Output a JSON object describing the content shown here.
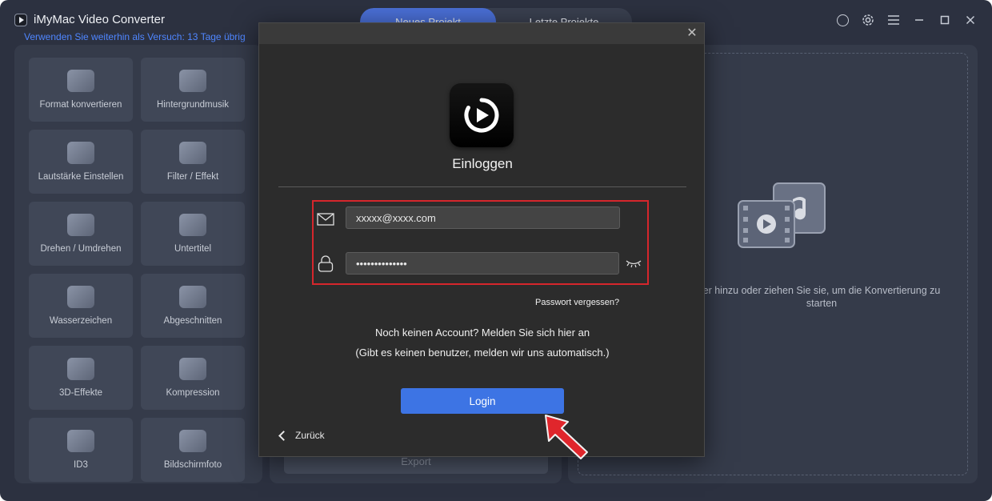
{
  "app": {
    "title": "iMyMac Video Converter",
    "trial_notice": "Verwenden Sie weiterhin als Versuch: 13 Tage übrig",
    "tabs": [
      {
        "label": "Neues Projekt",
        "active": true
      },
      {
        "label": "Letzte Projekte",
        "active": false
      }
    ],
    "window_icons": [
      "account-icon",
      "settings-icon",
      "menu-icon",
      "minimize-icon",
      "maximize-icon",
      "close-icon"
    ]
  },
  "tools": [
    {
      "label": "Format konvertieren",
      "icon": "format-convert-icon"
    },
    {
      "label": "Hintergrundmusik",
      "icon": "background-music-icon"
    },
    {
      "label": "Lautstärke Einstellen",
      "icon": "volume-icon"
    },
    {
      "label": "Filter / Effekt",
      "icon": "filter-effect-icon"
    },
    {
      "label": "Drehen / Umdrehen",
      "icon": "rotate-flip-icon"
    },
    {
      "label": "Untertitel",
      "icon": "subtitle-icon"
    },
    {
      "label": "Wasserzeichen",
      "icon": "watermark-icon"
    },
    {
      "label": "Abgeschnitten",
      "icon": "crop-icon"
    },
    {
      "label": "3D-Effekte",
      "icon": "3d-glasses-icon"
    },
    {
      "label": "Kompression",
      "icon": "compression-icon"
    },
    {
      "label": "ID3",
      "icon": "id3-icon"
    },
    {
      "label": "Bildschirmfoto",
      "icon": "screenshot-icon"
    }
  ],
  "middle": {
    "export_label": "Export"
  },
  "drop": {
    "text_line1": "er hinzu oder ziehen Sie sie, um die Konvertierung zu",
    "text_line2": "starten"
  },
  "login": {
    "title": "Einloggen",
    "email_value": "xxxxx@xxxx.com",
    "password_value": "••••••••••••••",
    "forgot_label": "Passwort vergessen?",
    "no_account": "Noch keinen Account? Melden Sie sich hier an",
    "auto_note": "(Gibt es keinen benutzer, melden wir uns automatisch.)",
    "login_button": "Login",
    "back_label": "Zurück"
  },
  "colors": {
    "accent": "#3d74e4",
    "highlight_box": "#d6262c",
    "trial_text": "#4f86ff"
  }
}
